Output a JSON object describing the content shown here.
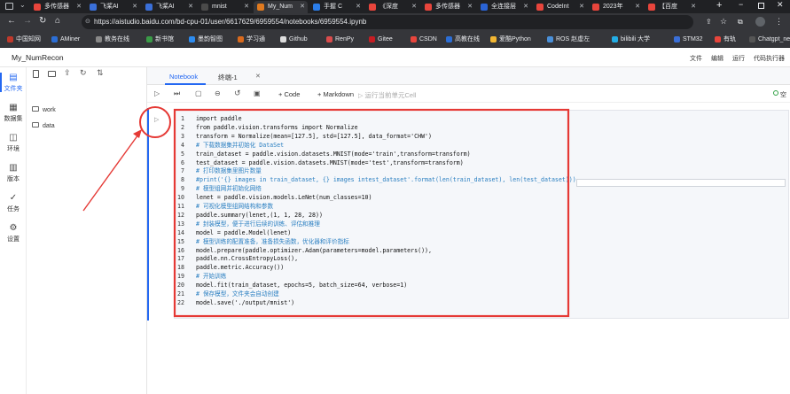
{
  "browser": {
    "tabs": [
      {
        "label": "多传感器",
        "color": "#e8453c"
      },
      {
        "label": "飞桨AI",
        "color": "#3a6fd8"
      },
      {
        "label": "飞桨AI",
        "color": "#3a6fd8"
      },
      {
        "label": "mnist",
        "color": "#4a4a4a"
      },
      {
        "label": "My_Num",
        "color": "#e07a1f"
      },
      {
        "label": "手握 C",
        "color": "#2b7de9"
      },
      {
        "label": "《深度",
        "color": "#e8453c"
      },
      {
        "label": "多传感器",
        "color": "#e8453c"
      },
      {
        "label": "全连接层",
        "color": "#2a63d4"
      },
      {
        "label": "CodeInt",
        "color": "#e8453c"
      },
      {
        "label": "2023年",
        "color": "#e8453c"
      },
      {
        "label": "【百度",
        "color": "#e8453c"
      }
    ],
    "url": "https://aistudio.baidu.com/bd-cpu-01/user/6617629/6959554/notebooks/6959554.ipynb",
    "bookmarks": [
      {
        "label": "中国知网",
        "color": "#c0392b"
      },
      {
        "label": "AMiner",
        "color": "#2c6ed5"
      },
      {
        "label": "教务在线",
        "color": "#888888"
      },
      {
        "label": "新书馆",
        "color": "#3a9b47"
      },
      {
        "label": "墨韵智图",
        "color": "#2d8cf0"
      },
      {
        "label": "学习通",
        "color": "#d96a1d"
      },
      {
        "label": "Github",
        "color": "#dddddd"
      },
      {
        "label": "RenPy",
        "color": "#d94c4c"
      },
      {
        "label": "Gitee",
        "color": "#c71d23"
      },
      {
        "label": "CSDN",
        "color": "#e8453c"
      },
      {
        "label": "高教在线",
        "color": "#2c6ed5"
      },
      {
        "label": "爱酷Python",
        "color": "#f2b632"
      },
      {
        "label": "ROS 赵虚左",
        "color": "#4a90d9"
      },
      {
        "label": "bilibili 大学",
        "color": "#23ade5"
      },
      {
        "label": "STM32",
        "color": "#3a6fd8"
      },
      {
        "label": "有轨",
        "color": "#e8453c"
      },
      {
        "label": "Chatgpt_new",
        "color": "#555555"
      }
    ]
  },
  "app": {
    "project_title": "My_NumRecon",
    "menu": [
      "文件",
      "编辑",
      "运行",
      "代码执行器"
    ]
  },
  "rail": [
    {
      "label": "文件夹",
      "icon": "files-icon"
    },
    {
      "label": "数据集",
      "icon": "dataset-icon"
    },
    {
      "label": "环境",
      "icon": "env-icon"
    },
    {
      "label": "版本",
      "icon": "version-icon"
    },
    {
      "label": "任务",
      "icon": "task-icon"
    },
    {
      "label": "设置",
      "icon": "settings-icon"
    }
  ],
  "files": {
    "items": [
      "work",
      "data"
    ]
  },
  "notebook": {
    "tabs": [
      "Notebook",
      "终端-1"
    ],
    "toolbar": {
      "code": "+ Code",
      "markdown": "+ Markdown",
      "run_selected": "运行当前单元Cell",
      "status": "空"
    },
    "lines": [
      "1",
      "2",
      "3",
      "4",
      "5",
      "6",
      "7",
      "8",
      "9",
      "10",
      "11",
      "12",
      "13",
      "14",
      "15",
      "16",
      "17",
      "18",
      "19",
      "20",
      "21",
      "22"
    ],
    "code": [
      "import paddle",
      "from paddle.vision.transforms import Normalize",
      "transform = Normalize(mean=[127.5], std=[127.5], data_format='CHW')",
      "# 下载数据集并初始化 DataSet",
      "train_dataset = paddle.vision.datasets.MNIST(mode='train',transform=transform)",
      "test_dataset = paddle.vision.datasets.MNIST(mode='test',transform=transform)",
      "# 打印数据集里图片数量",
      "#print('{} images in train_dataset, {} images intest_dataset'.format(len(train_dataset), len(test_dataset)))",
      "# 模型组网并初始化网络",
      "lenet = paddle.vision.models.LeNet(num_classes=10)",
      "# 可视化模型组网结构和参数",
      "paddle.summary(lenet,(1, 1, 28, 28))",
      "# 封装模型，便于进行后续的训练、评估和推理",
      "model = paddle.Model(lenet)",
      "# 模型训练的配置准备，准备损失函数，优化器和评价指标",
      "model.prepare(paddle.optimizer.Adam(parameters=model.parameters()),",
      "paddle.nn.CrossEntropyLoss(),",
      "paddle.metric.Accuracy())",
      "# 开始训练",
      "model.fit(train_dataset, epochs=5, batch_size=64, verbose=1)",
      "# 保存模型，文件夹会自动创建",
      "model.save('./output/mnist')"
    ]
  },
  "colors": {
    "annotation": "#e53935",
    "accent": "#2468f2"
  }
}
